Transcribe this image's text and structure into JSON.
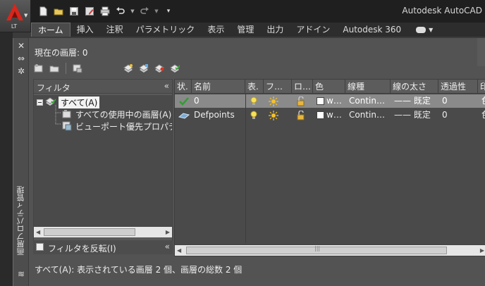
{
  "app": {
    "title": "Autodesk AutoCAD",
    "edition_badge": "LT"
  },
  "quick_access": [
    {
      "icon": "new-icon"
    },
    {
      "icon": "open-icon"
    },
    {
      "icon": "save-icon"
    },
    {
      "icon": "save-as-icon"
    },
    {
      "icon": "plot-icon"
    },
    {
      "icon": "undo-icon"
    },
    {
      "icon": "redo-icon"
    },
    {
      "icon": "customize-icon"
    }
  ],
  "ribbon": {
    "tabs": [
      {
        "label": "ホーム",
        "active": true
      },
      {
        "label": "挿入",
        "active": false
      },
      {
        "label": "注釈",
        "active": false
      },
      {
        "label": "パラメトリック",
        "active": false
      },
      {
        "label": "表示",
        "active": false
      },
      {
        "label": "管理",
        "active": false
      },
      {
        "label": "出力",
        "active": false
      },
      {
        "label": "アドイン",
        "active": false
      },
      {
        "label": "Autodesk 360",
        "active": false
      }
    ]
  },
  "palette": {
    "vertical_title": "画層プロパティ管理",
    "current_layer": "現在の画層: 0",
    "filter": {
      "header": "フィルタ",
      "collapse_glyph": "«",
      "tree": [
        {
          "label": "すべて(A)",
          "level": 0,
          "selected": true
        },
        {
          "label": "すべての使用中の画層(A)",
          "level": 1,
          "selected": false
        },
        {
          "label": "ビューポート優先プロパティ",
          "level": 1,
          "selected": false
        }
      ],
      "invert_label": "フィルタを反転(I)",
      "invert_checked": false
    },
    "columns": [
      {
        "key": "status",
        "label": "状."
      },
      {
        "key": "name",
        "label": "名前"
      },
      {
        "key": "on",
        "label": "表."
      },
      {
        "key": "freeze",
        "label": "フ…"
      },
      {
        "key": "lock",
        "label": "ロ…"
      },
      {
        "key": "color",
        "label": "色"
      },
      {
        "key": "linetype",
        "label": "線種"
      },
      {
        "key": "lineweight",
        "label": "線の太さ"
      },
      {
        "key": "transparency",
        "label": "透過性"
      },
      {
        "key": "plot_style",
        "label": "印"
      }
    ],
    "layers": [
      {
        "current": true,
        "name": "0",
        "color_label": "w…",
        "linetype": "Contin…",
        "lineweight": "—— 既定",
        "transparency": "0",
        "plot_style": "色",
        "selected": true
      },
      {
        "current": false,
        "name": "Defpoints",
        "color_label": "w…",
        "linetype": "Contin…",
        "lineweight": "—— 既定",
        "transparency": "0",
        "plot_style": "色",
        "selected": false
      }
    ],
    "status_text": "すべて(A): 表示されている画層 2 個、画層の総数 2 個"
  }
}
